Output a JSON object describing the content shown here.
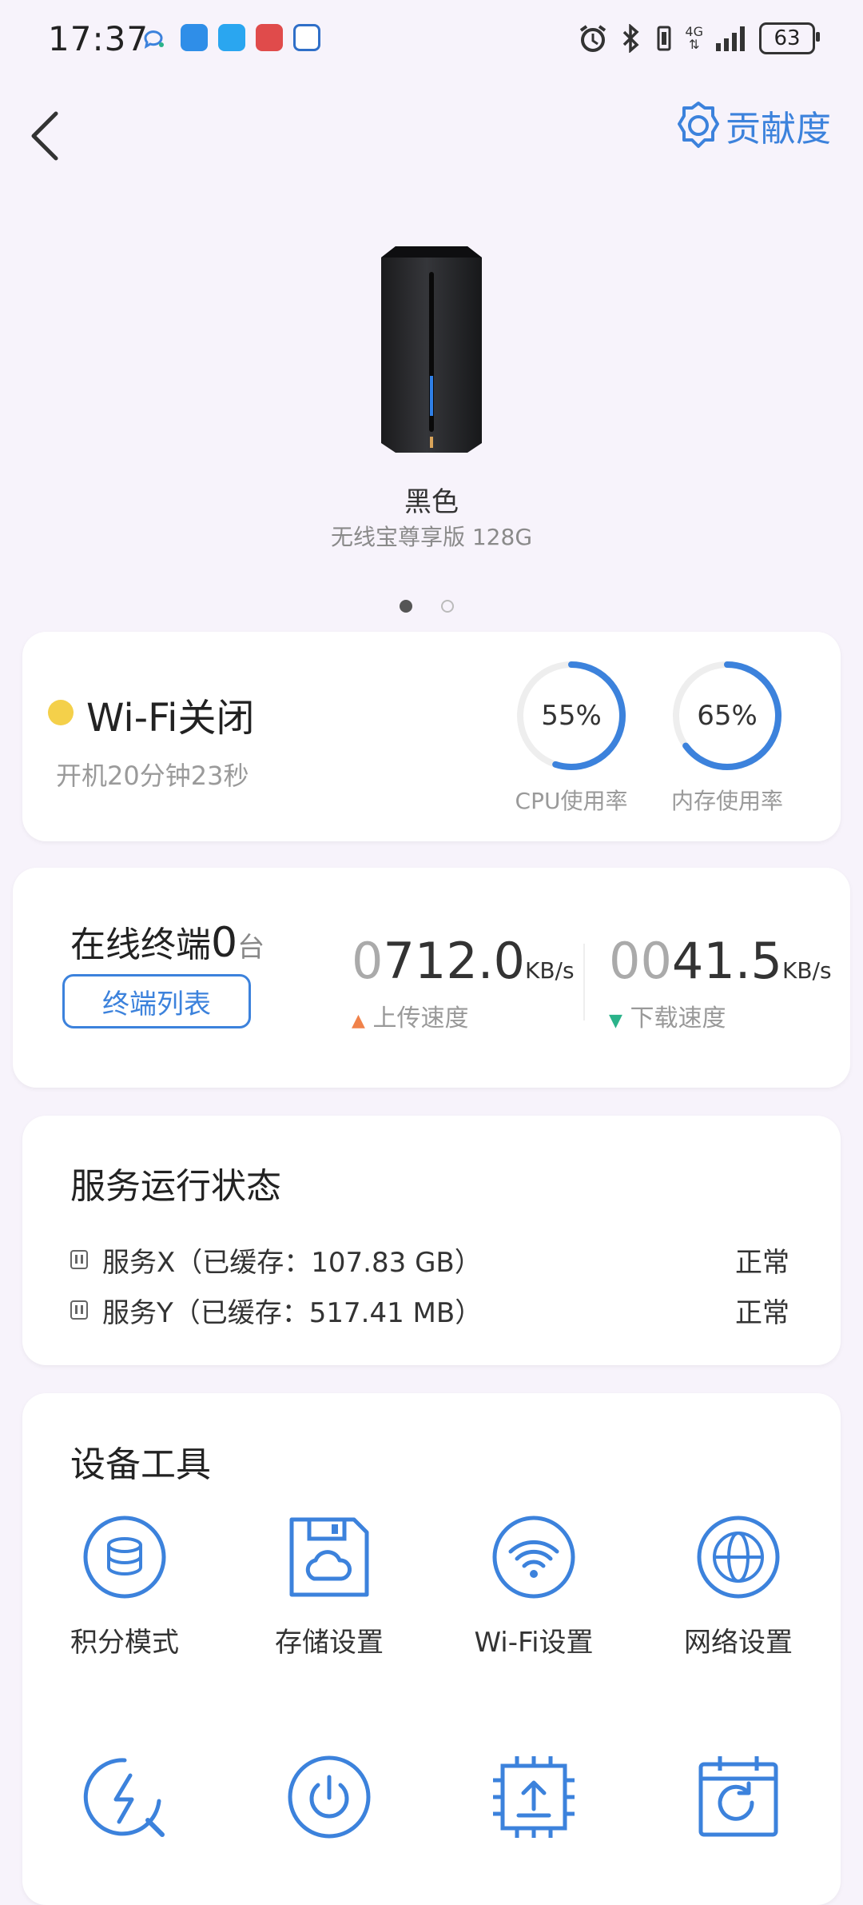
{
  "status_bar": {
    "time": "17:37",
    "battery": "63",
    "network": "4G",
    "icons": [
      "chat-icon",
      "weather-icon",
      "search-app-icon",
      "red-app-icon",
      "browser-app-icon",
      "alarm-icon",
      "bluetooth-icon",
      "vibrate-icon",
      "signal-icon",
      "battery-icon"
    ]
  },
  "header": {
    "back_icon": "chevron-left-icon",
    "contribution_label": "贡献度",
    "contribution_icon": "badge-icon"
  },
  "device": {
    "name": "黑色",
    "model": "无线宝尊享版 128G",
    "page_count": 2,
    "active_page": 1
  },
  "status_card": {
    "wifi_label": "Wi-Fi关闭",
    "wifi_dot_color": "#f4d04a",
    "uptime": "开机20分钟23秒",
    "cpu": {
      "value": "55%",
      "label": "CPU使用率",
      "fraction": 0.55
    },
    "memory": {
      "value": "65%",
      "label": "内存使用率",
      "fraction": 0.65
    }
  },
  "terminal_card": {
    "online_label": "在线终端",
    "online_count": "0",
    "online_unit": "台",
    "list_button": "终端列表",
    "upload": {
      "prefix": "0",
      "value": "712.0",
      "unit": "KB/s",
      "label": "上传速度",
      "arrow": "▲",
      "arrow_color": "#f0824a"
    },
    "download": {
      "prefix": "00",
      "value": "41.5",
      "unit": "KB/s",
      "label": "下载速度",
      "arrow": "▼",
      "arrow_color": "#2bb38a"
    }
  },
  "services": {
    "title": "服务运行状态",
    "items": [
      {
        "name": "服务X（已缓存：107.83 GB）",
        "status": "正常"
      },
      {
        "name": "服务Y（已缓存：517.41 MB）",
        "status": "正常"
      }
    ]
  },
  "tools": {
    "title": "设备工具",
    "items": [
      {
        "label": "积分模式",
        "icon": "database-icon"
      },
      {
        "label": "存储设置",
        "icon": "cloud-storage-icon"
      },
      {
        "label": "Wi-Fi设置",
        "icon": "wifi-icon"
      },
      {
        "label": "网络设置",
        "icon": "globe-icon"
      },
      {
        "label": "",
        "icon": "speed-test-icon"
      },
      {
        "label": "",
        "icon": "power-icon"
      },
      {
        "label": "",
        "icon": "upgrade-chip-icon"
      },
      {
        "label": "",
        "icon": "scheduled-restart-icon"
      }
    ]
  },
  "colors": {
    "accent": "#3c82dc",
    "background": "#f7f3fb"
  }
}
